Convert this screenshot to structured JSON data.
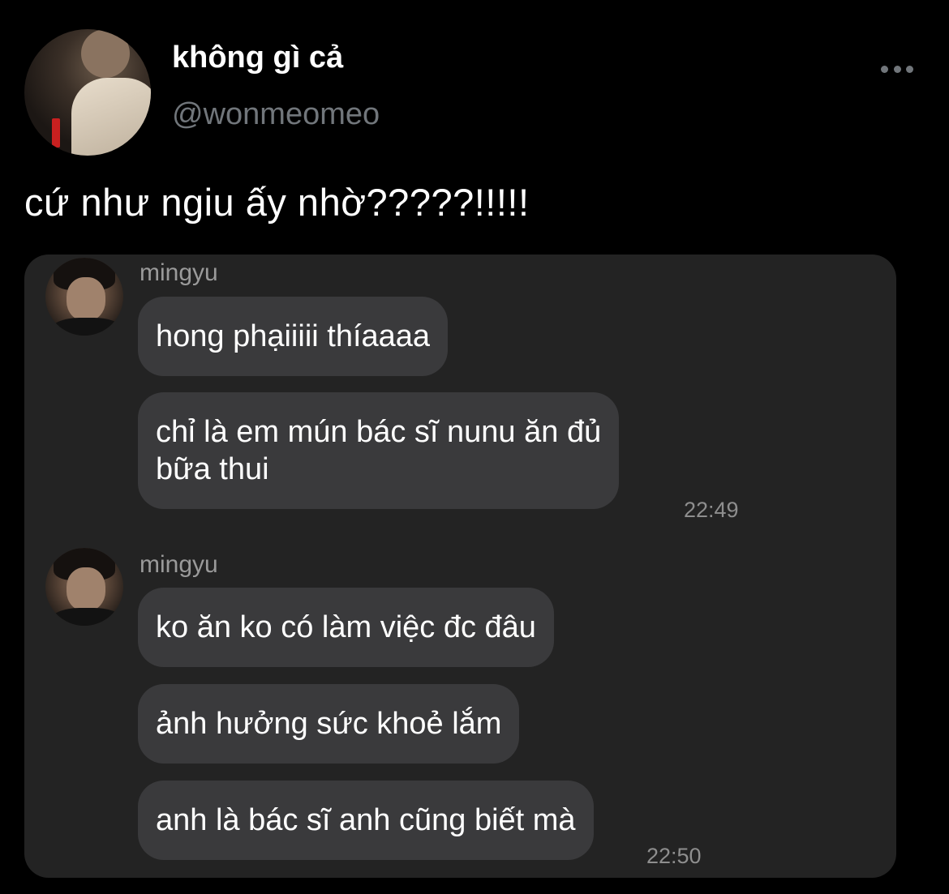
{
  "tweet": {
    "display_name": "không gì cả",
    "handle": "@wonmeomeo",
    "text": "cứ như ngiu ấy nhờ?????!!!!!"
  },
  "chat": {
    "groups": [
      {
        "sender": "mingyu",
        "messages": [
          "hong phạiiiii thíaaaa",
          "chỉ là em mún bác sĩ nunu ăn đủ\nbữa thui"
        ],
        "time": "22:49"
      },
      {
        "sender": "mingyu",
        "messages": [
          "ko ăn ko có làm việc đc đâu",
          "ảnh hưởng sức khoẻ lắm",
          "anh là bác sĩ anh cũng biết mà"
        ],
        "time": "22:50"
      }
    ]
  },
  "colors": {
    "background": "#000000",
    "media_background": "#232323",
    "bubble": "#3a3a3c",
    "secondary_text": "#71767b"
  },
  "icons": {
    "more": "more-horizontal-icon"
  }
}
